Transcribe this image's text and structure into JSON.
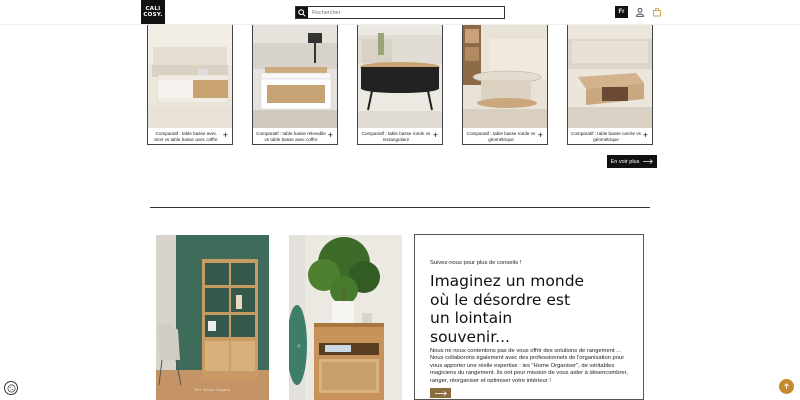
{
  "header": {
    "logo_line1": "CALI",
    "logo_line2": "COSY.",
    "search_placeholder": "Rechercher",
    "lang": "Fr",
    "icons": [
      "search-icon",
      "user-icon",
      "bag-icon"
    ]
  },
  "products": [
    {
      "label": "Comparatif : table basse avec tiroir vs table basse avec coffre"
    },
    {
      "label": "Comparatif : table basse relevable vs table basse avec coffre"
    },
    {
      "label": "Comparatif : table basse ronde vs rectangulaire"
    },
    {
      "label": "Comparatif : table basse ronde vs géométrique"
    },
    {
      "label": "Comparatif : table basse carrée vs géométrique"
    }
  ],
  "see_more": {
    "label": "En voir plus"
  },
  "photos": [
    {
      "caption": "Ref. Marlon Étagère"
    },
    {
      "caption": ""
    }
  ],
  "content_box": {
    "kicker": "Suivez-nous pour plus de conseils !",
    "headline": "Imaginez un monde où le désordre est un lointain souvenir...",
    "body": "Nous ne nous contentons pas de vous offrir des solutions de rangement ... Nous collaborons également avec des professionnels de l'organisation pour vous apporter une réelle expertise : les \"Home Organiser\", de véritables magiciens du rangement. Ils ont pour mission de vous aider à désencombrer, ranger, réorganiser et optimiser votre intérieur !"
  },
  "colors": {
    "accent": "#c58a2c",
    "brown_button": "#8a6c3e",
    "dark": "#111111"
  }
}
